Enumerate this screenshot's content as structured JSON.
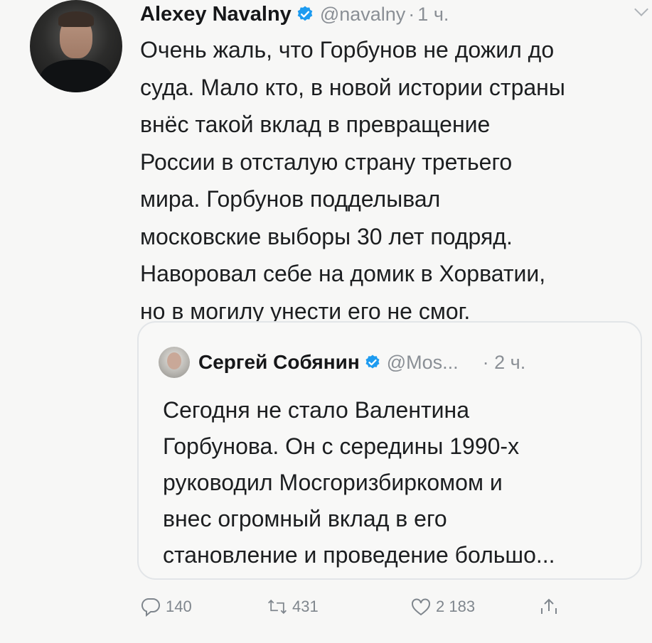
{
  "tweet": {
    "author_name": "Alexey Navalny",
    "handle": "@navalny",
    "separator": "·",
    "time": "1 ч.",
    "text_lines": [
      "Очень жаль, что Горбунов не дожил до",
      "суда. Мало кто, в новой истории страны",
      "внёс такой вклад в превращение",
      "России в отсталую страну третьего",
      "мира. Горбунов подделывал",
      "московские выборы 30 лет подряд.",
      "Наворовал себе на домик в Хорватии,",
      "но в могилу унести его не смог."
    ]
  },
  "quoted": {
    "author_name": "Сергей Собянин",
    "handle": "@Mos...",
    "time": "· 2 ч.",
    "text_lines": [
      "Сегодня не стало Валентина",
      "Горбунова. Он с середины 1990-х",
      "руководил Мосгоризбиркомом и",
      "внес огромный вклад в его",
      "становление и проведение большо..."
    ]
  },
  "actions": {
    "replies": "140",
    "retweets": "431",
    "likes": "2 183"
  },
  "icons": {
    "verified": "verified-badge-icon",
    "reply": "reply-icon",
    "retweet": "retweet-icon",
    "like": "heart-icon",
    "share": "share-icon",
    "menu": "chevron-down-icon"
  },
  "colors": {
    "verified_blue": "#1d9bf0",
    "secondary_text": "#8a8f95",
    "background": "#f7f7f6"
  }
}
